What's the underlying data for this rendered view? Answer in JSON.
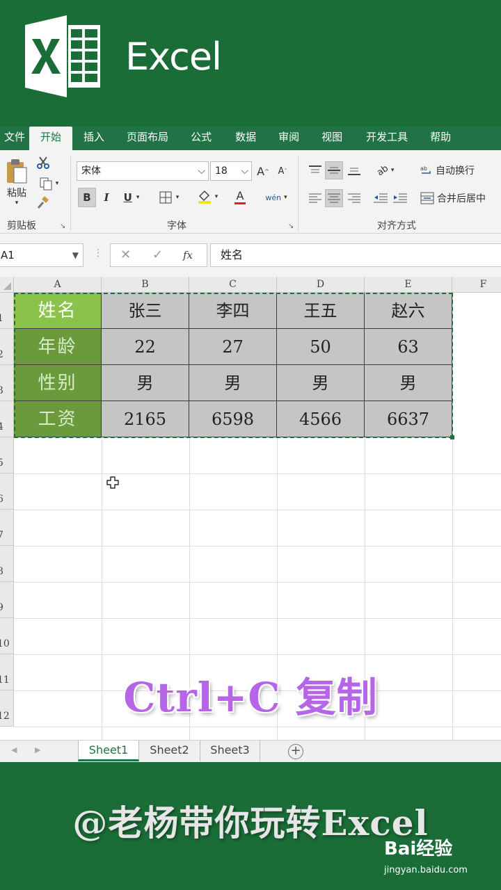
{
  "app": {
    "title": "Excel"
  },
  "ribbon": {
    "tabs": [
      "文件",
      "开始",
      "插入",
      "页面布局",
      "公式",
      "数据",
      "审阅",
      "视图",
      "开发工具",
      "帮助"
    ],
    "active_tab": "开始",
    "clipboard": {
      "paste_label": "粘贴",
      "group_label": "剪贴板"
    },
    "font": {
      "name": "宋体",
      "size": "18",
      "group_label": "字体",
      "bold": "B",
      "italic": "I",
      "underline": "U",
      "grow": "A",
      "shrink": "A",
      "color_letter": "A",
      "phonetic": "wén"
    },
    "alignment": {
      "group_label": "对齐方式",
      "wrap_text": "自动换行",
      "merge_center": "合并后居中",
      "orientation": "ab"
    }
  },
  "formula_bar": {
    "name_box": "A1",
    "cancel": "✕",
    "enter": "✓",
    "fx": "fx",
    "value": "姓名"
  },
  "sheet": {
    "columns": [
      "A",
      "B",
      "C",
      "D",
      "E",
      "F"
    ],
    "rows": [
      "1",
      "2",
      "3",
      "4",
      "5",
      "6",
      "7",
      "8",
      "9",
      "10",
      "11",
      "12"
    ],
    "table": [
      [
        "姓名",
        "张三",
        "李四",
        "王五",
        "赵六"
      ],
      [
        "年龄",
        "22",
        "27",
        "50",
        "63"
      ],
      [
        "性别",
        "男",
        "男",
        "男",
        "男"
      ],
      [
        "工资",
        "2165",
        "6598",
        "4566",
        "6637"
      ]
    ],
    "header_color": "#8bc34a",
    "header_dark_color": "#6a9a3c",
    "body_fill": "#c5c5c5",
    "selection_color": "#1e6e3a"
  },
  "caption": "Ctrl+C 复制",
  "sheet_tabs": {
    "tabs": [
      "Sheet1",
      "Sheet2",
      "Sheet3"
    ],
    "active": "Sheet1",
    "add": "+"
  },
  "footer": {
    "watermark": "@老杨带你玩转Excel",
    "brand": "Bai经验",
    "brand_sub": "jingyan.baidu.com"
  }
}
